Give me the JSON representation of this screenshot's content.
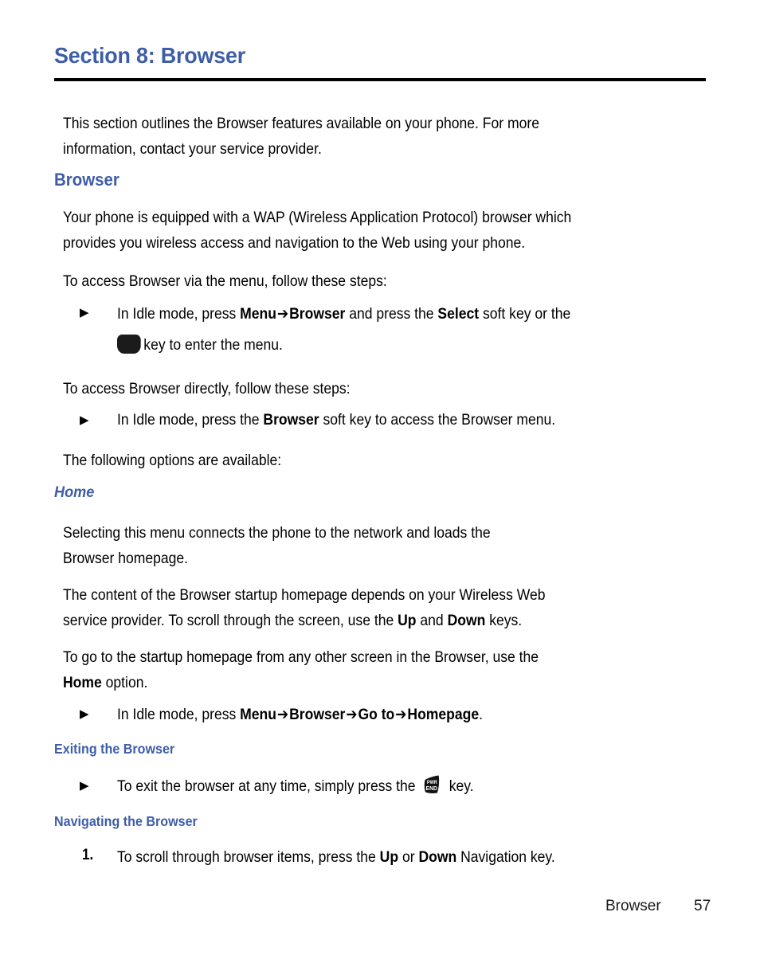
{
  "page": {
    "section_title": "Section 8: Browser",
    "footer_label": "Browser",
    "footer_page_number": "57",
    "accent_color": "#3E5DA8",
    "text_color": "#000000",
    "background_color": "#FFFFFF",
    "rule_color": "#000000"
  },
  "intro": {
    "line1": "This section outlines the Browser features available on your phone. For more",
    "line2": "information, contact your service provider."
  },
  "browser_section": {
    "heading": "Browser",
    "para1_line1": "Your phone is equipped with a WAP (Wireless Application Protocol) browser which",
    "para1_line2": "provides you wireless access and navigation to the Web using your phone.",
    "para2": "To access Browser via the menu, follow these steps:",
    "bullet1": {
      "marker": "triangle-bullet-icon",
      "seg_a": "In Idle mode, press ",
      "seg_b_bold": "Menu",
      "arrow": "➔",
      "seg_c_bold": "Browser",
      "seg_d": " and press the ",
      "seg_e_bold": "Select",
      "seg_f": " soft key or the",
      "line2_icon": "ok-key-icon",
      "line2_text": "key to enter the menu."
    },
    "para3": "To access Browser directly, follow these steps:",
    "bullet2": {
      "marker": "triangle-bullet-icon",
      "seg_a": "In Idle mode, press the ",
      "seg_b_bold": "Browser",
      "seg_c": " soft key to access the Browser menu."
    },
    "para4": "The following options are available:"
  },
  "home_section": {
    "heading": "Home",
    "para1_line1": "Selecting this menu connects the phone to the network and loads the",
    "para1_line2": "Browser homepage.",
    "para2_line1": "The content of the Browser startup homepage depends on your Wireless Web",
    "para2_line2_a": "service provider. To scroll through the screen, use the ",
    "para2_line2_b_bold": "Up",
    "para2_line2_c": " and ",
    "para2_line2_d_bold": "Down",
    "para2_line2_e": " keys.",
    "para3_line1": "To go to the startup homepage from any other screen in the Browser, use the",
    "para3_line2_a_bold": "Home",
    "para3_line2_b": " option.",
    "bullet1": {
      "marker": "triangle-bullet-icon",
      "seg_a": "In Idle mode, press ",
      "seg_b_bold": "Menu",
      "arrow1": "➔",
      "seg_c_bold": "Browser",
      "arrow2": "➔",
      "seg_d_bold": "Go to",
      "arrow3": "➔",
      "seg_e_bold": "Homepage",
      "seg_f": "."
    }
  },
  "exiting_section": {
    "heading": "Exiting the Browser",
    "bullet1": {
      "marker": "triangle-bullet-icon",
      "seg_a": "To exit the browser at any time, simply press the ",
      "key_icon": "pwr-end-key-icon",
      "key_icon_line1": "PWR",
      "key_icon_line2": "END",
      "seg_b": " key."
    }
  },
  "navigating_section": {
    "heading": "Navigating the Browser",
    "item1": {
      "marker": "1.",
      "seg_a": "To scroll through browser items, press the ",
      "seg_b_bold": "Up",
      "seg_c": " or ",
      "seg_d_bold": "Down",
      "seg_e": " Navigation key."
    }
  }
}
